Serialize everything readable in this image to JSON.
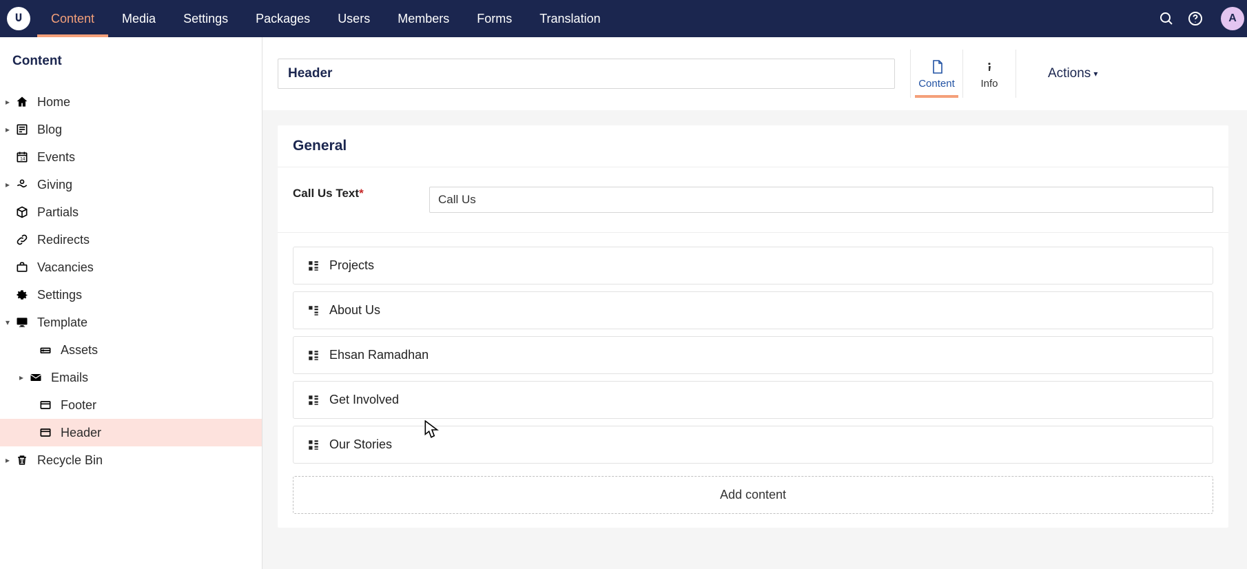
{
  "topnav": {
    "items": [
      {
        "label": "Content",
        "active": true
      },
      {
        "label": "Media"
      },
      {
        "label": "Settings"
      },
      {
        "label": "Packages"
      },
      {
        "label": "Users"
      },
      {
        "label": "Members"
      },
      {
        "label": "Forms"
      },
      {
        "label": "Translation"
      }
    ],
    "avatar_initial": "A"
  },
  "sidebar": {
    "title": "Content",
    "items": [
      {
        "label": "Home",
        "icon": "home",
        "caret": true,
        "level": 1
      },
      {
        "label": "Blog",
        "icon": "blog",
        "caret": true,
        "level": 1
      },
      {
        "label": "Events",
        "icon": "calendar",
        "caret": false,
        "level": 1
      },
      {
        "label": "Giving",
        "icon": "giving",
        "caret": true,
        "level": 1
      },
      {
        "label": "Partials",
        "icon": "box",
        "caret": false,
        "level": 1
      },
      {
        "label": "Redirects",
        "icon": "link",
        "caret": false,
        "level": 1
      },
      {
        "label": "Vacancies",
        "icon": "briefcase",
        "caret": false,
        "level": 1
      },
      {
        "label": "Settings",
        "icon": "gear",
        "caret": false,
        "level": 1
      },
      {
        "label": "Template",
        "icon": "display",
        "caret": true,
        "caret_open": true,
        "level": 1
      },
      {
        "label": "Assets",
        "icon": "drive",
        "caret": false,
        "level": 3
      },
      {
        "label": "Emails",
        "icon": "mail",
        "caret": true,
        "level": 2
      },
      {
        "label": "Footer",
        "icon": "window",
        "caret": false,
        "level": 3
      },
      {
        "label": "Header",
        "icon": "window",
        "caret": false,
        "level": 3,
        "selected": true
      },
      {
        "label": "Recycle Bin",
        "icon": "trash",
        "caret": true,
        "level": 1
      }
    ]
  },
  "editor": {
    "title_value": "Header",
    "tabs": [
      {
        "label": "Content",
        "icon": "doc",
        "active": true
      },
      {
        "label": "Info",
        "icon": "info"
      }
    ],
    "actions_label": "Actions",
    "panel_title": "General",
    "field": {
      "label": "Call Us Text",
      "required": true,
      "value": "Call Us"
    },
    "content_items": [
      {
        "label": "Projects"
      },
      {
        "label": "About Us"
      },
      {
        "label": "Ehsan Ramadhan"
      },
      {
        "label": "Get Involved"
      },
      {
        "label": "Our Stories"
      }
    ],
    "add_content_label": "Add content"
  }
}
